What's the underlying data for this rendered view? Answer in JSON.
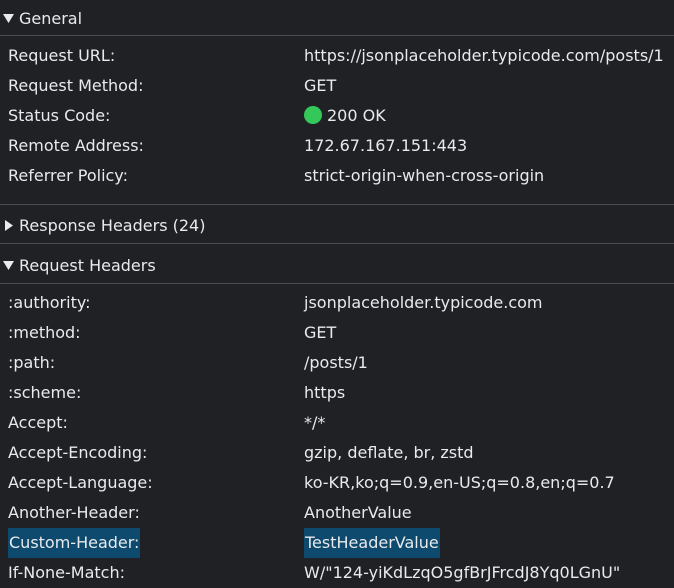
{
  "sections": {
    "general": {
      "title": "General",
      "expanded": true,
      "rows": [
        {
          "name": "Request URL:",
          "value": "https://jsonplaceholder.typicode.com/posts/1"
        },
        {
          "name": "Request Method:",
          "value": "GET"
        },
        {
          "name": "Status Code:",
          "value": "200 OK",
          "status_color": "#34c759"
        },
        {
          "name": "Remote Address:",
          "value": "172.67.167.151:443"
        },
        {
          "name": "Referrer Policy:",
          "value": "strict-origin-when-cross-origin"
        }
      ]
    },
    "response_headers": {
      "title": "Response Headers (24)",
      "expanded": false
    },
    "request_headers": {
      "title": "Request Headers",
      "expanded": true,
      "rows": [
        {
          "name": ":authority:",
          "value": "jsonplaceholder.typicode.com"
        },
        {
          "name": ":method:",
          "value": "GET"
        },
        {
          "name": ":path:",
          "value": "/posts/1"
        },
        {
          "name": ":scheme:",
          "value": "https"
        },
        {
          "name": "Accept:",
          "value": "*/*"
        },
        {
          "name": "Accept-Encoding:",
          "value": "gzip, deflate, br, zstd"
        },
        {
          "name": "Accept-Language:",
          "value": "ko-KR,ko;q=0.9,en-US;q=0.8,en;q=0.7"
        },
        {
          "name": "Another-Header:",
          "value": "AnotherValue"
        },
        {
          "name": "Custom-Header:",
          "value": "TestHeaderValue",
          "highlighted": true
        },
        {
          "name": "If-None-Match:",
          "value": "W/\"124-yiKdLzqO5gfBrJFrcdJ8Yq0LGnU\""
        }
      ]
    }
  },
  "colors": {
    "background": "#202124",
    "text": "#e8eaed",
    "divider": "#4a4c50",
    "highlight": "#0e4a6e",
    "status_ok": "#34c759"
  }
}
